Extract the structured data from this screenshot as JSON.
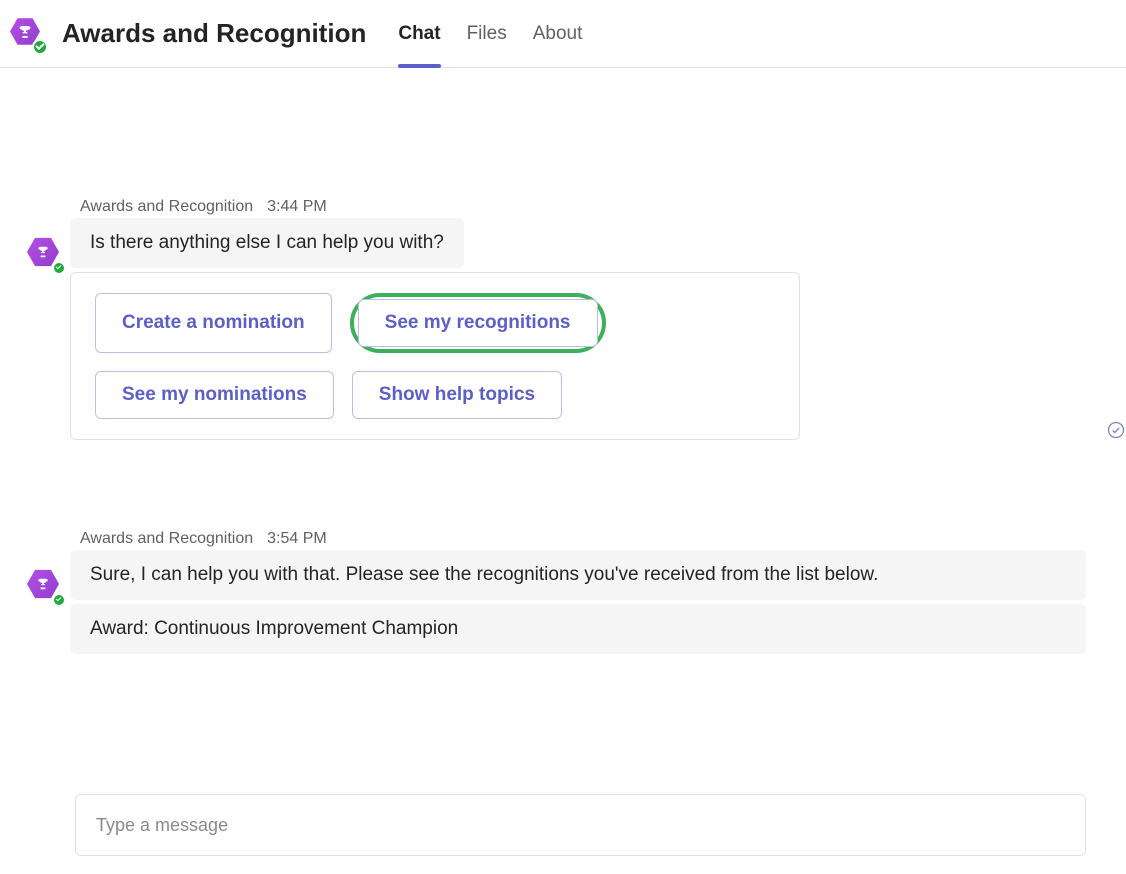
{
  "app": {
    "title": "Awards and Recognition"
  },
  "tabs": [
    {
      "label": "Chat",
      "active": true
    },
    {
      "label": "Files",
      "active": false
    },
    {
      "label": "About",
      "active": false
    }
  ],
  "messages": [
    {
      "sender": "Awards and Recognition",
      "time": "3:44 PM",
      "text": "Is there anything else I can help you with?",
      "actions_card": {
        "rows": [
          [
            {
              "label": "Create a nomination",
              "highlight": false
            },
            {
              "label": "See my recognitions",
              "highlight": true
            }
          ],
          [
            {
              "label": "See my nominations",
              "highlight": false
            },
            {
              "label": "Show help topics",
              "highlight": false
            }
          ]
        ]
      }
    },
    {
      "sender": "Awards and Recognition",
      "time": "3:54 PM",
      "text": "Sure, I can help you with that. Please see the recognitions you've received from the list below.",
      "award_line": "Award: Continuous Improvement Champion"
    }
  ],
  "compose": {
    "placeholder": "Type a message"
  }
}
